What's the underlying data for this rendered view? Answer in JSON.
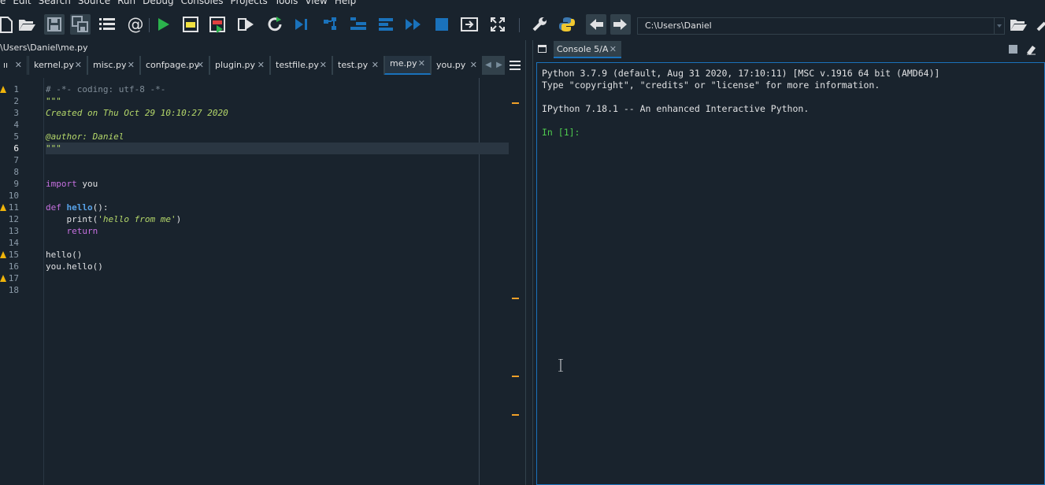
{
  "menu": [
    "e",
    "Edit",
    "Search",
    "Source",
    "Run",
    "Debug",
    "Consoles",
    "Projects",
    "Tools",
    "View",
    "Help"
  ],
  "toolbar": {
    "buttons": [
      "new-file-icon",
      "open-file-icon",
      "save-icon",
      "save-all-icon",
      "outline-icon",
      "at-icon",
      "run-icon",
      "run-cell-icon",
      "run-cell-advance-icon",
      "run-selection-icon",
      "rerun-icon",
      "debug-step-icon",
      "debug-step-into-icon",
      "debug-step-return-icon",
      "debug-continue-icon",
      "debug-stop-icon",
      "maximize-pane-icon",
      "fullscreen-icon",
      "wrench-icon",
      "python-path-icon",
      "back-arrow-icon",
      "forward-arrow-icon",
      "open-folder-icon",
      "browse-icon"
    ],
    "working_dir": "C:\\Users\\Daniel"
  },
  "editor": {
    "path": "\\Users\\Daniel\\me.py",
    "tabs": [
      {
        "label": "ıı",
        "close": "✕"
      },
      {
        "label": "kernel.py",
        "close": "✕"
      },
      {
        "label": "misc.py",
        "close": "✕"
      },
      {
        "label": "confpage.py",
        "close": "✕"
      },
      {
        "label": "plugin.py",
        "close": "✕"
      },
      {
        "label": "testfile.py",
        "close": "✕"
      },
      {
        "label": "test.py",
        "close": "✕"
      },
      {
        "label": "me.py",
        "close": "✕"
      },
      {
        "label": "you.py",
        "close": "✕"
      }
    ],
    "line_numbers": [
      "1",
      "2",
      "3",
      "4",
      "5",
      "6",
      "7",
      "8",
      "9",
      "10",
      "11",
      "12",
      "13",
      "14",
      "15",
      "16",
      "17",
      "18"
    ],
    "code": {
      "l1": "# -*- coding: utf-8 -*-",
      "l2": "\"\"\"",
      "l3": "Created on Thu Oct 29 10:10:27 2020",
      "l5": "@author: Daniel",
      "l6": "\"\"\"",
      "l9_kw": "import",
      "l9_rest": " you",
      "l11_kw": "def",
      "l11_fn": "hello",
      "l11_rest": "():",
      "l12_a": "    print(",
      "l12_str": "'hello from me'",
      "l12_b": ")",
      "l13_kw": "    return",
      "l15": "hello()",
      "l16": "you.hello()"
    }
  },
  "console": {
    "tab_label": "Console 5/A",
    "tab_close": "✕",
    "lines": [
      "Python 3.7.9 (default, Aug 31 2020, 17:10:11) [MSC v.1916 64 bit (AMD64)]",
      "Type \"copyright\", \"credits\" or \"license\" for more information.",
      "",
      "IPython 7.18.1 -- An enhanced Interactive Python.",
      ""
    ],
    "prompt": "In [1]:"
  },
  "colors": {
    "background": "#19232d",
    "accent": "#1a72bb",
    "warning": "#f0b40a",
    "keyword": "#c670e0",
    "string": "#b5d86a",
    "prompt": "#4ec94e"
  }
}
